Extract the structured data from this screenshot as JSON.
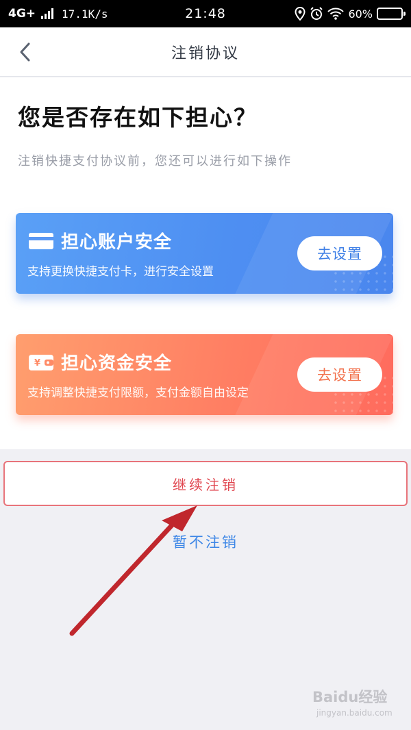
{
  "status_bar": {
    "network": "4G+",
    "speed": "17.1K/s",
    "time": "21:48",
    "battery": "60%",
    "battery_level": 0.6,
    "icons": [
      "signal-icon",
      "location-icon",
      "alarm-icon",
      "wifi-icon",
      "battery-icon"
    ]
  },
  "nav": {
    "title": "注销协议",
    "back_icon": "chevron-left-icon"
  },
  "main": {
    "headline": "您是否存在如下担心？",
    "subtitle": "注销快捷支付协议前，您还可以进行如下操作"
  },
  "cards": [
    {
      "icon": "card-icon",
      "title": "担心账户安全",
      "description": "支持更换快捷支付卡，进行安全设置",
      "button": "去设置",
      "color": "#4e8ff2"
    },
    {
      "icon": "wallet-icon",
      "title": "担心资金安全",
      "description": "支持调整快捷支付限额，支付金额自由设定",
      "button": "去设置",
      "color": "#ff7f63"
    }
  ],
  "actions": {
    "continue": "继续注销",
    "cancel": "暂不注销"
  },
  "watermark": {
    "brand": "Baidu经验",
    "url": "jingyan.baidu.com"
  },
  "colors": {
    "accent_red": "#e0464f",
    "link_blue": "#3c86e6",
    "annotation_arrow": "#c0272d"
  }
}
